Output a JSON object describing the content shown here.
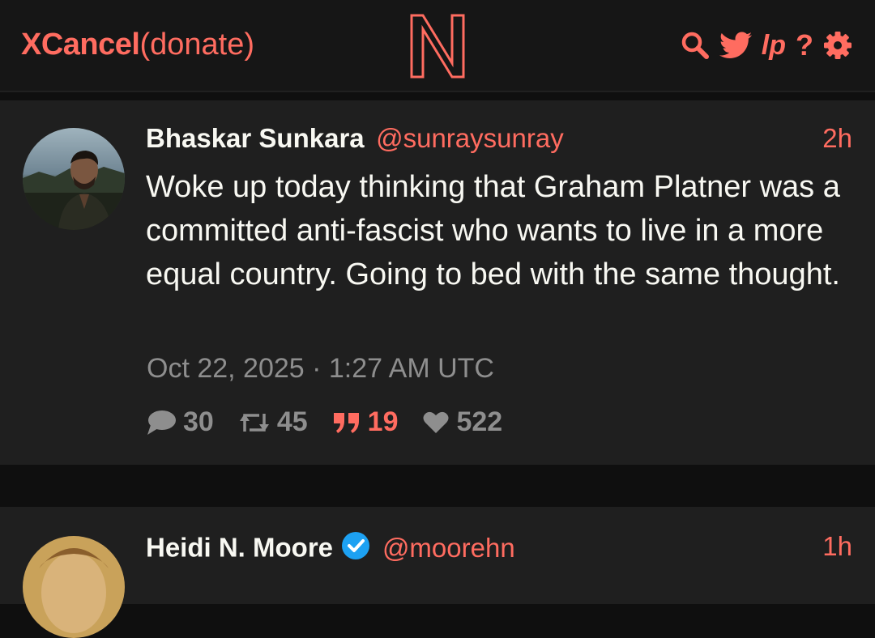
{
  "nav": {
    "brand_name": "XCancel",
    "donate_label": "(donate)",
    "logo_letter": "N",
    "icons": [
      "search-icon",
      "twitter-bird-icon",
      "liberapay-icon",
      "help-icon",
      "settings-gear-icon"
    ],
    "liberapay_label": "lp",
    "help_label": "?"
  },
  "colors": {
    "accent": "#ff6c60",
    "background": "#0f0f0f",
    "panel": "#1f1f1f",
    "navbar": "#161616",
    "text": "#f8f8f2",
    "muted": "#8e8e8e",
    "verified": "#1da1f2"
  },
  "tweets": [
    {
      "fullname": "Bhaskar Sunkara",
      "username": "@sunraysunray",
      "date": "2h",
      "content": "Woke up today thinking that Graham Platner was a committed anti-fascist who wants to live in a more equal country. Going to bed with the same thought.",
      "published": "Oct 22, 2025 · 1:27 AM UTC",
      "stats": {
        "replies": "30",
        "retweets": "45",
        "quotes": "19",
        "likes": "522"
      }
    },
    {
      "fullname": "Heidi N. Moore",
      "verified": true,
      "username": "@moorehn",
      "date": "1h"
    }
  ]
}
